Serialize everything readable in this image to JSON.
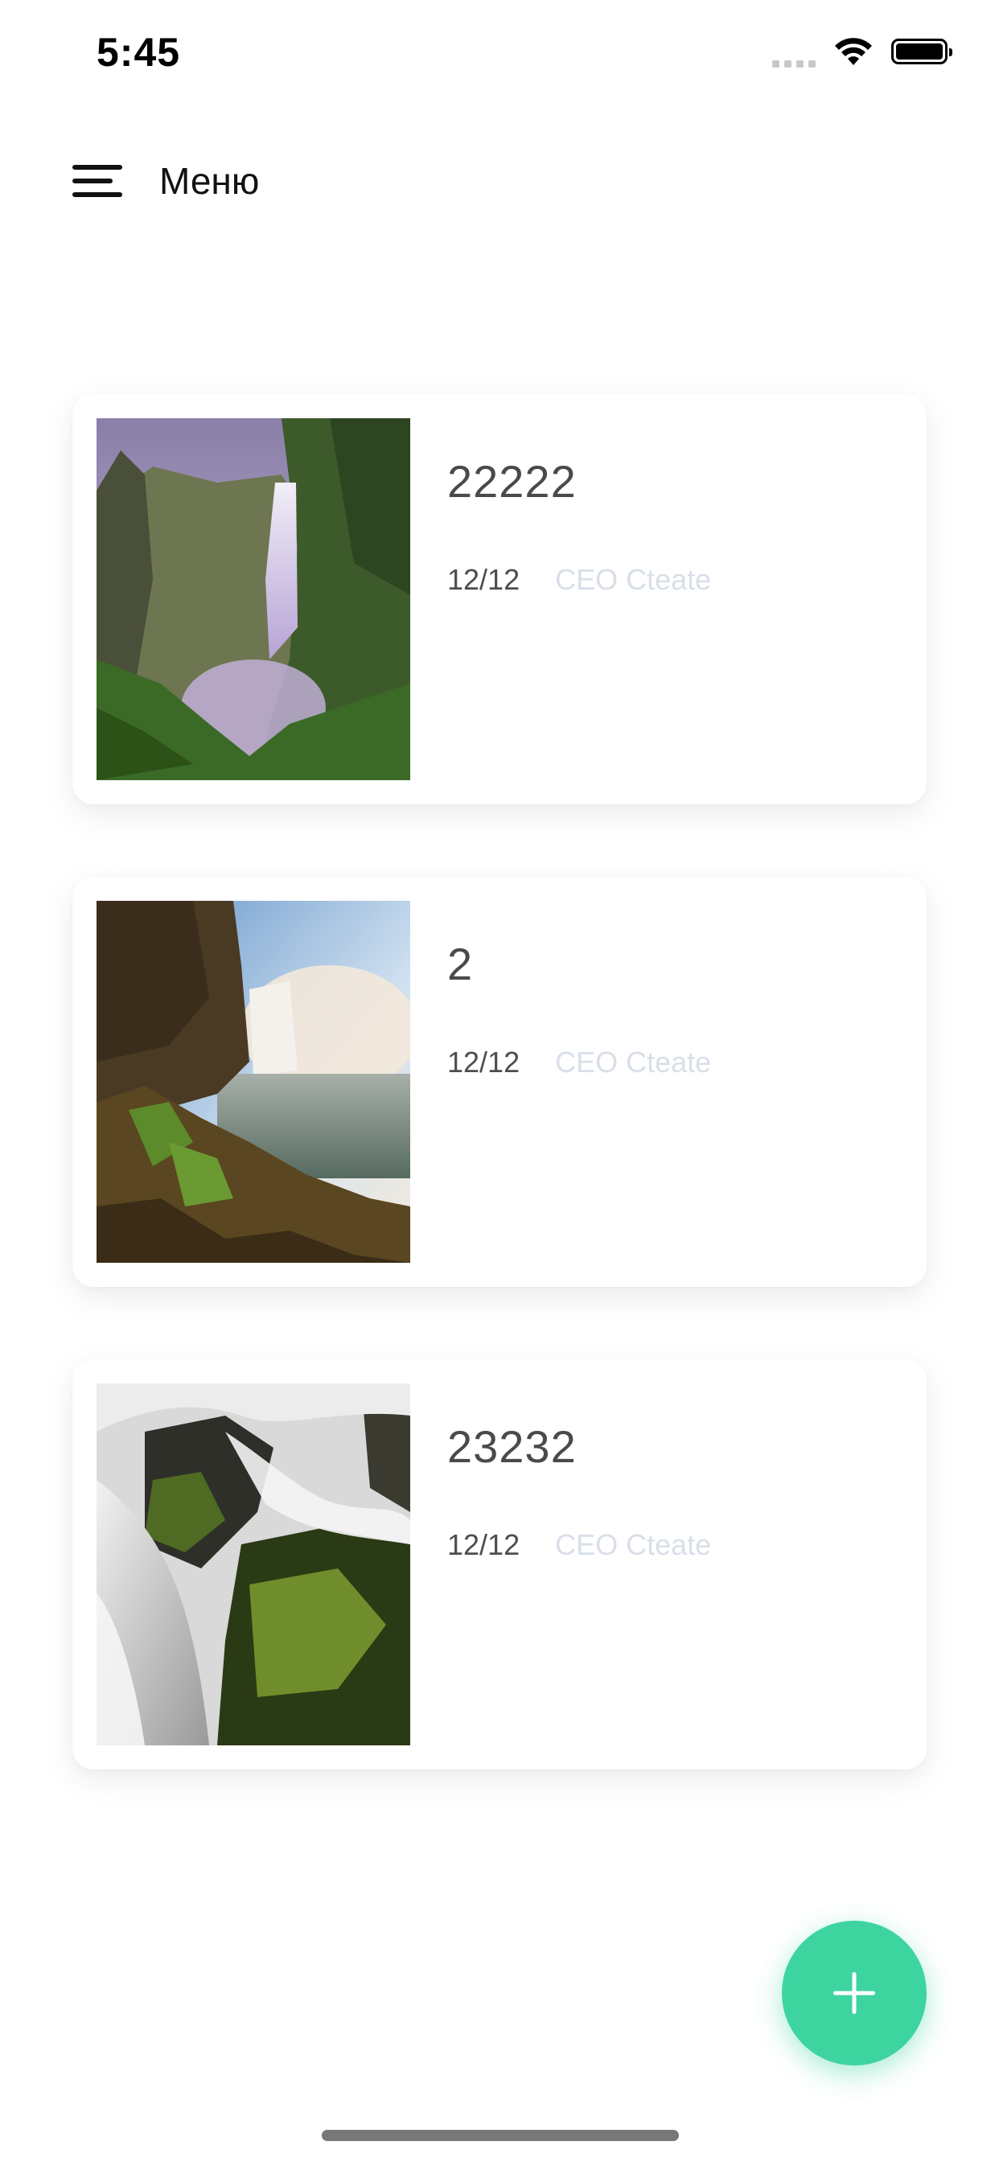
{
  "status_bar": {
    "time": "5:45"
  },
  "header": {
    "title": "Меню",
    "menu_icon": "hamburger-menu-icon"
  },
  "cards": [
    {
      "title": "22222",
      "date": "12/12",
      "author": "CEO Cteate",
      "image": "waterfall-cliff-photo"
    },
    {
      "title": "2",
      "date": "12/12",
      "author": "CEO Cteate",
      "image": "waterfall-coast-photo"
    },
    {
      "title": "23232",
      "date": "12/12",
      "author": "CEO Cteate",
      "image": "waterfall-rocks-photo"
    }
  ],
  "fab": {
    "icon": "plus-icon",
    "color": "#3dd4a0"
  }
}
